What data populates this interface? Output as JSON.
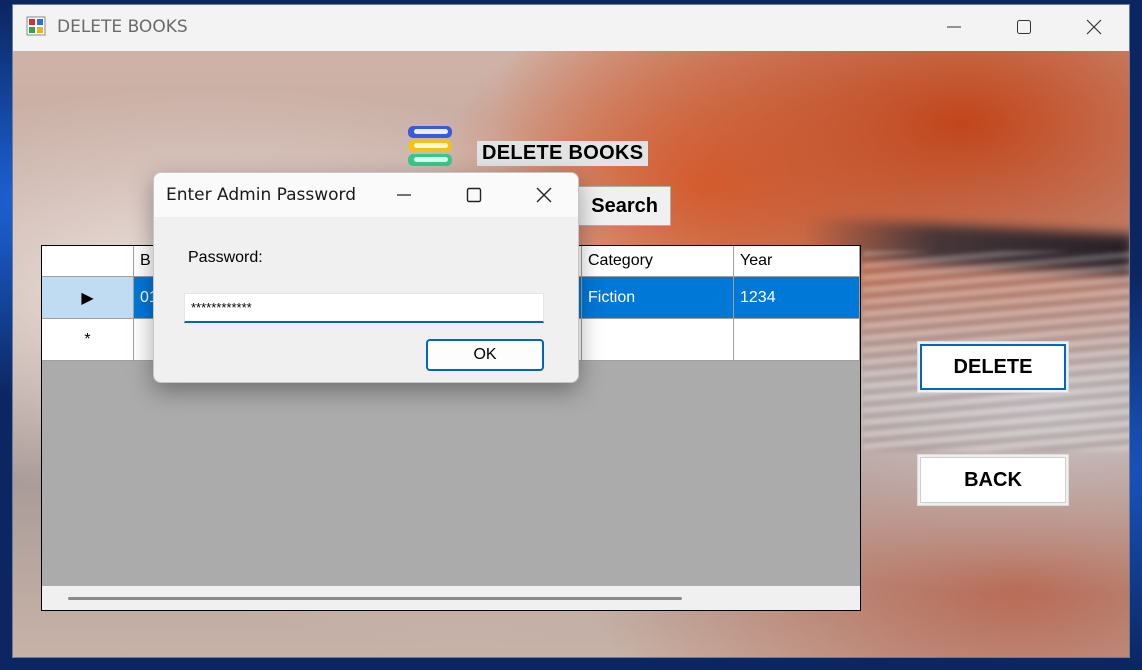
{
  "window": {
    "title": "DELETE BOOKS"
  },
  "form": {
    "heading": "DELETE BOOKS",
    "search_label": "Search",
    "delete_label": "DELETE",
    "back_label": "BACK"
  },
  "grid": {
    "columns": [
      "B",
      "Category",
      "Year"
    ],
    "rows": [
      {
        "marker": "▶",
        "id": "01",
        "category": "Fiction",
        "year": "1234"
      },
      {
        "marker": "*",
        "id": "",
        "category": "",
        "year": ""
      }
    ]
  },
  "dialog": {
    "title": "Enter Admin Password",
    "label": "Password:",
    "password_value": "************",
    "ok_label": "OK"
  },
  "colors": {
    "accent": "#0067c0",
    "selection": "#0078d7"
  }
}
